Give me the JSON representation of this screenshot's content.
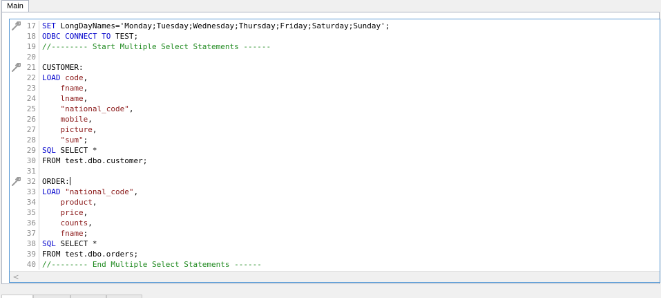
{
  "tabs": {
    "main_label": "Main"
  },
  "editor": {
    "lines": [
      {
        "num": "17",
        "mark": true,
        "tokens": [
          {
            "t": "SET",
            "c": "k"
          },
          {
            "t": " LongDayNames='Monday;Tuesday;Wednesday;Thursday;Friday;Saturday;Sunday';",
            "c": ""
          }
        ]
      },
      {
        "num": "18",
        "mark": false,
        "tokens": [
          {
            "t": "ODBC CONNECT TO",
            "c": "k"
          },
          {
            "t": " TEST;",
            "c": ""
          }
        ]
      },
      {
        "num": "19",
        "mark": false,
        "tokens": [
          {
            "t": "//-------- Start Multiple Select Statements ------",
            "c": "c"
          }
        ]
      },
      {
        "num": "20",
        "mark": false,
        "tokens": []
      },
      {
        "num": "21",
        "mark": true,
        "tokens": [
          {
            "t": "CUSTOMER:",
            "c": ""
          }
        ]
      },
      {
        "num": "22",
        "mark": false,
        "tokens": [
          {
            "t": "LOAD",
            "c": "k"
          },
          {
            "t": " ",
            "c": ""
          },
          {
            "t": "code",
            "c": "f"
          },
          {
            "t": ",",
            "c": ""
          }
        ]
      },
      {
        "num": "23",
        "mark": false,
        "tokens": [
          {
            "t": "    ",
            "c": ""
          },
          {
            "t": "fname",
            "c": "f"
          },
          {
            "t": ",",
            "c": ""
          }
        ]
      },
      {
        "num": "24",
        "mark": false,
        "tokens": [
          {
            "t": "    ",
            "c": ""
          },
          {
            "t": "lname",
            "c": "f"
          },
          {
            "t": ",",
            "c": ""
          }
        ]
      },
      {
        "num": "25",
        "mark": false,
        "tokens": [
          {
            "t": "    ",
            "c": ""
          },
          {
            "t": "\"national_code\"",
            "c": "s"
          },
          {
            "t": ",",
            "c": ""
          }
        ]
      },
      {
        "num": "26",
        "mark": false,
        "tokens": [
          {
            "t": "    ",
            "c": ""
          },
          {
            "t": "mobile",
            "c": "f"
          },
          {
            "t": ",",
            "c": ""
          }
        ]
      },
      {
        "num": "27",
        "mark": false,
        "tokens": [
          {
            "t": "    ",
            "c": ""
          },
          {
            "t": "picture",
            "c": "f"
          },
          {
            "t": ",",
            "c": ""
          }
        ]
      },
      {
        "num": "28",
        "mark": false,
        "tokens": [
          {
            "t": "    ",
            "c": ""
          },
          {
            "t": "\"sum\"",
            "c": "s"
          },
          {
            "t": ";",
            "c": ""
          }
        ]
      },
      {
        "num": "29",
        "mark": false,
        "tokens": [
          {
            "t": "SQL",
            "c": "k"
          },
          {
            "t": " SELECT *",
            "c": ""
          }
        ]
      },
      {
        "num": "30",
        "mark": false,
        "tokens": [
          {
            "t": "FROM test.dbo.customer;",
            "c": ""
          }
        ]
      },
      {
        "num": "31",
        "mark": false,
        "tokens": []
      },
      {
        "num": "32",
        "mark": true,
        "caret": true,
        "tokens": [
          {
            "t": "ORDER:",
            "c": ""
          }
        ]
      },
      {
        "num": "33",
        "mark": false,
        "tokens": [
          {
            "t": "LOAD",
            "c": "k"
          },
          {
            "t": " ",
            "c": ""
          },
          {
            "t": "\"national_code\"",
            "c": "s"
          },
          {
            "t": ",",
            "c": ""
          }
        ]
      },
      {
        "num": "34",
        "mark": false,
        "tokens": [
          {
            "t": "    ",
            "c": ""
          },
          {
            "t": "product",
            "c": "f"
          },
          {
            "t": ",",
            "c": ""
          }
        ]
      },
      {
        "num": "35",
        "mark": false,
        "tokens": [
          {
            "t": "    ",
            "c": ""
          },
          {
            "t": "price",
            "c": "f"
          },
          {
            "t": ",",
            "c": ""
          }
        ]
      },
      {
        "num": "36",
        "mark": false,
        "tokens": [
          {
            "t": "    ",
            "c": ""
          },
          {
            "t": "counts",
            "c": "f"
          },
          {
            "t": ",",
            "c": ""
          }
        ]
      },
      {
        "num": "37",
        "mark": false,
        "tokens": [
          {
            "t": "    ",
            "c": ""
          },
          {
            "t": "fname",
            "c": "f"
          },
          {
            "t": ";",
            "c": ""
          }
        ]
      },
      {
        "num": "38",
        "mark": false,
        "tokens": [
          {
            "t": "SQL",
            "c": "k"
          },
          {
            "t": " SELECT *",
            "c": ""
          }
        ]
      },
      {
        "num": "39",
        "mark": false,
        "tokens": [
          {
            "t": "FROM test.dbo.orders;",
            "c": ""
          }
        ]
      },
      {
        "num": "40",
        "mark": false,
        "tokens": [
          {
            "t": "//-------- End Multiple Select Statements ------",
            "c": "c"
          }
        ]
      }
    ]
  },
  "scrollbar": {
    "left_arrow": "<"
  },
  "colors": {
    "keyword": "#0000cc",
    "field": "#8b1a1a",
    "comment": "#1f8a1f",
    "line_number": "#8a8a8a",
    "editor_border": "#5b9bd5"
  },
  "icons": {
    "gutter_marker": "wrench-icon"
  }
}
